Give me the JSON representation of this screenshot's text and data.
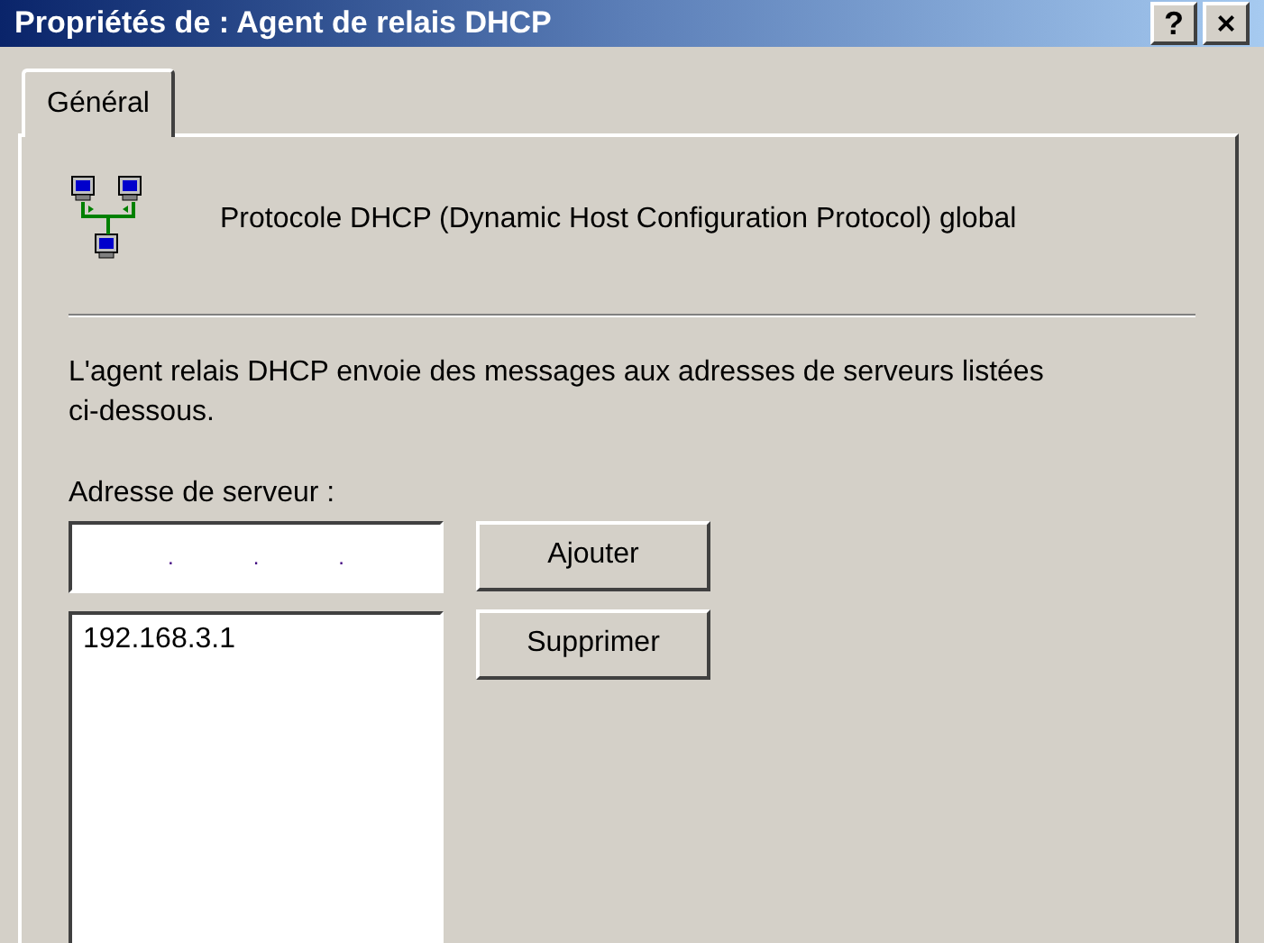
{
  "window": {
    "title": "Propriétés de : Agent de relais DHCP",
    "title_buttons": [
      "?",
      "×"
    ]
  },
  "tabs": [
    {
      "label": "Général",
      "selected": true
    }
  ],
  "heading": "Protocole DHCP (Dynamic Host Configuration Protocol) global",
  "description": "L'agent relais DHCP envoie des messages aux adresses de serveurs listées ci-dessous.",
  "server_address": {
    "label": "Adresse de serveur :",
    "separators": [
      ".",
      ".",
      "."
    ]
  },
  "buttons": [
    "Ajouter",
    "Supprimer"
  ],
  "servers": [
    {
      "address": "192.168.3.1",
      "selected": false
    }
  ]
}
